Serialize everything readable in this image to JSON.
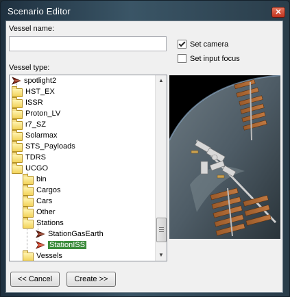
{
  "window": {
    "title": "Scenario Editor",
    "close_glyph": "✕"
  },
  "form": {
    "vessel_name_label": "Vessel name:",
    "vessel_name_value": "",
    "vessel_type_label": "Vessel type:",
    "set_camera": {
      "label": "Set camera",
      "checked": true
    },
    "set_input_focus": {
      "label": "Set input focus",
      "checked": false
    }
  },
  "tree": {
    "items": [
      {
        "label": "spotlight2",
        "icon": "ship-icon",
        "depth": 0
      },
      {
        "label": "HST_EX",
        "icon": "folder-icon",
        "depth": 0
      },
      {
        "label": "ISSR",
        "icon": "folder-icon",
        "depth": 0
      },
      {
        "label": "Proton_LV",
        "icon": "folder-icon",
        "depth": 0
      },
      {
        "label": "r7_SZ",
        "icon": "folder-icon",
        "depth": 0
      },
      {
        "label": "Solarmax",
        "icon": "folder-icon",
        "depth": 0
      },
      {
        "label": "STS_Payloads",
        "icon": "folder-icon",
        "depth": 0
      },
      {
        "label": "TDRS",
        "icon": "folder-icon",
        "depth": 0
      },
      {
        "label": "UCGO",
        "icon": "folder-icon",
        "depth": 0
      },
      {
        "label": "bin",
        "icon": "folder-icon",
        "depth": 1
      },
      {
        "label": "Cargos",
        "icon": "folder-icon",
        "depth": 1
      },
      {
        "label": "Cars",
        "icon": "folder-icon",
        "depth": 1
      },
      {
        "label": "Other",
        "icon": "folder-icon",
        "depth": 1
      },
      {
        "label": "Stations",
        "icon": "folder-icon",
        "depth": 1
      },
      {
        "label": "StationGasEarth",
        "icon": "ship-icon",
        "depth": 2
      },
      {
        "label": "StationISS",
        "icon": "ship-icon",
        "depth": 2,
        "selected": true
      },
      {
        "label": "Vessels",
        "icon": "folder-icon",
        "depth": 1
      }
    ]
  },
  "buttons": {
    "cancel": "<< Cancel",
    "create": "Create >>"
  },
  "colors": {
    "selection": "#3c8c3c",
    "title_text": "#ffffff"
  }
}
